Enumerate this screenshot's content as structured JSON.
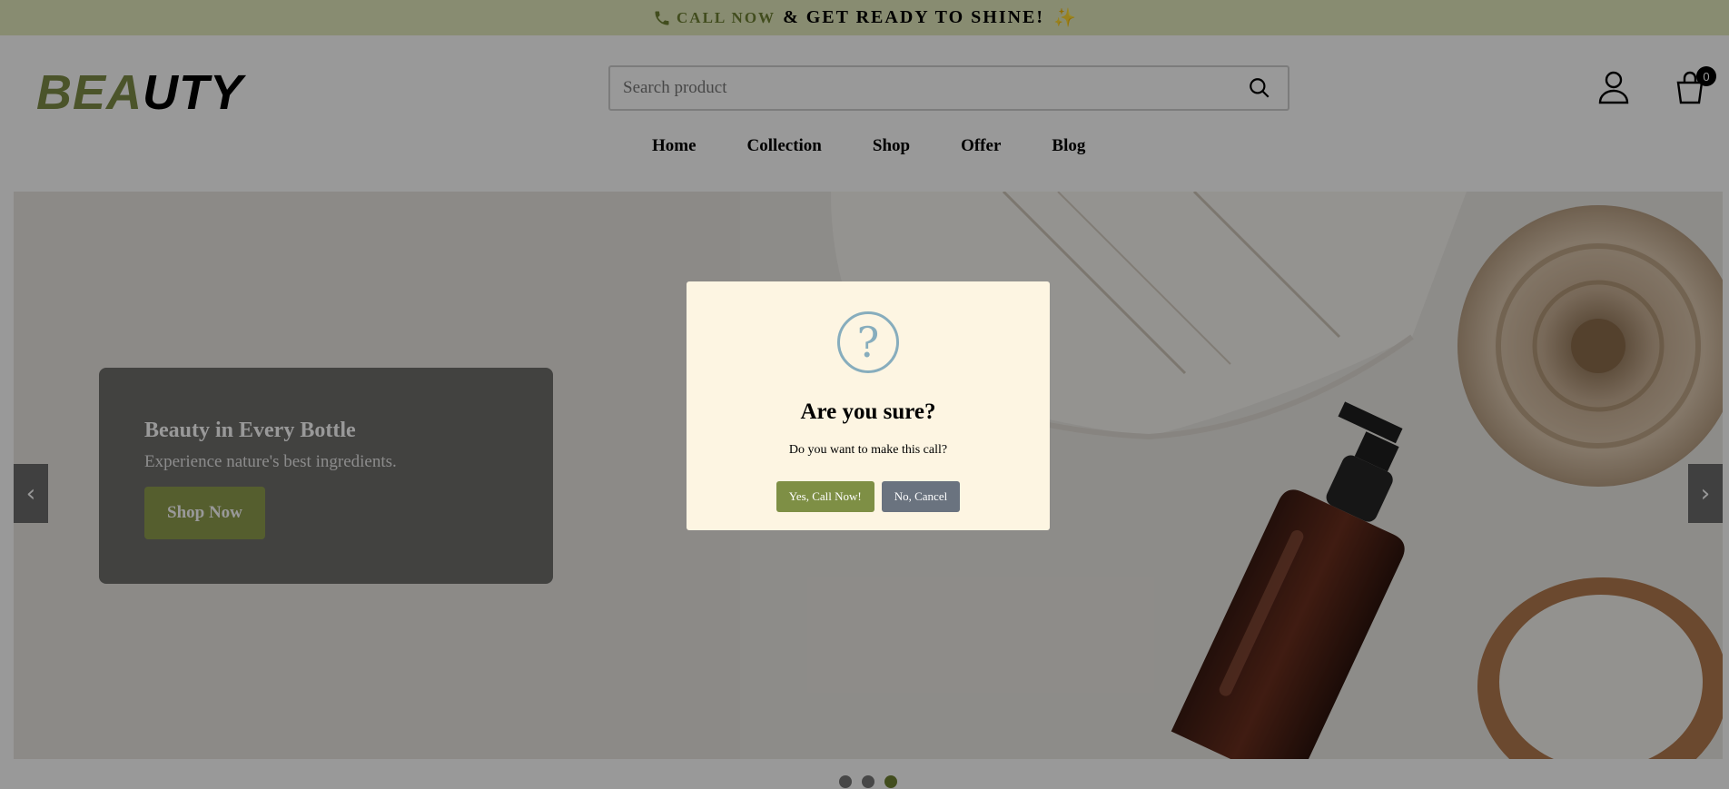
{
  "topbar": {
    "phone_icon": "phone-icon",
    "call_label": "CALL NOW",
    "message": "& GET READY TO SHINE!",
    "sparkle": "✨"
  },
  "header": {
    "logo_part1": "BEA",
    "logo_part2": "UTY",
    "search_placeholder": "Search product",
    "cart_count": "0"
  },
  "nav": {
    "items": [
      "Home",
      "Collection",
      "Shop",
      "Offer",
      "Blog"
    ]
  },
  "hero": {
    "title": "Beauty in Every Bottle",
    "subtitle": "Experience nature's best ingredients.",
    "button": "Shop Now",
    "prev_arrow": "‹",
    "next_arrow": "›",
    "slides": 3,
    "active_slide": 3
  },
  "modal": {
    "icon": "?",
    "title": "Are you sure?",
    "message": "Do you want to make this call?",
    "confirm": "Yes, Call Now!",
    "cancel": "No, Cancel"
  },
  "colors": {
    "accent": "#7e8c46",
    "topbar_bg": "#e3e9bd",
    "modal_bg": "#fdf5e2",
    "cancel_btn": "#6a737f"
  }
}
